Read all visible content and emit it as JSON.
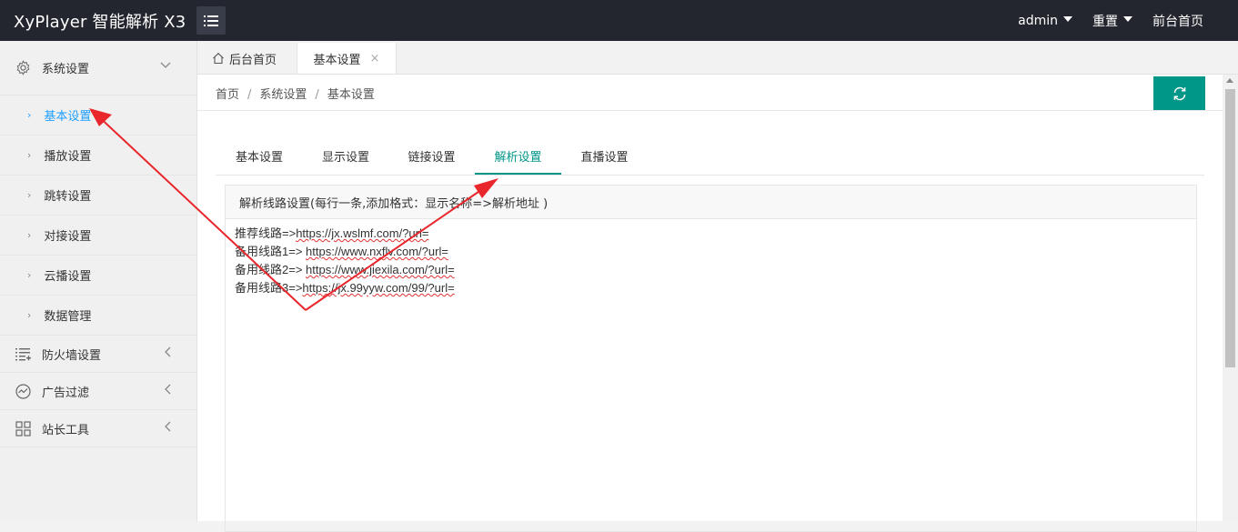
{
  "header": {
    "brand": "XyPlayer 智能解析 X3",
    "user": "admin",
    "reset": "重置",
    "frontend": "前台首页"
  },
  "sidebar": {
    "groups": [
      {
        "label": "系统设置",
        "icon": "gear-icon",
        "expanded": true
      },
      {
        "label": "防火墙设置",
        "icon": "list-icon"
      },
      {
        "label": "广告过滤",
        "icon": "chart-circle-icon"
      },
      {
        "label": "站长工具",
        "icon": "grid-icon"
      }
    ],
    "items": [
      {
        "label": "基本设置",
        "active": true
      },
      {
        "label": "播放设置"
      },
      {
        "label": "跳转设置"
      },
      {
        "label": "对接设置"
      },
      {
        "label": "云播设置"
      },
      {
        "label": "数据管理"
      }
    ]
  },
  "tabs": {
    "home": "后台首页",
    "current": "基本设置"
  },
  "breadcrumb": [
    "首页",
    "系统设置",
    "基本设置"
  ],
  "subtabs": [
    "基本设置",
    "显示设置",
    "链接设置",
    "解析设置",
    "直播设置"
  ],
  "active_subtab": "解析设置",
  "panel": {
    "title": "解析线路设置(每行一条,添加格式：显示名称=>解析地址 )",
    "lines": [
      {
        "name": "推荐线路=>",
        "url": "https://jx.wslmf.com/?url="
      },
      {
        "name": "备用线路1=> ",
        "url": "https://www.nxflv.com/?url="
      },
      {
        "name": "备用线路2=> ",
        "url": "https://www.jiexila.com/?url="
      },
      {
        "name": "备用线路3=>",
        "url": "https://jx.99yyw.com/99/?url="
      }
    ]
  },
  "colors": {
    "topbar": "#23262e",
    "accent": "#009688",
    "active_link": "#1e9fff",
    "annotation_arrow": "#e8262b"
  }
}
